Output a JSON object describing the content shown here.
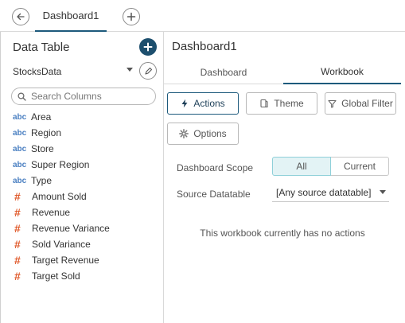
{
  "topbar": {
    "tab_label": "Dashboard1"
  },
  "left": {
    "title": "Data Table",
    "datasource": "StocksData",
    "search": {
      "placeholder": "Search Columns",
      "value": ""
    },
    "columns": [
      {
        "type": "abc",
        "label": "Area"
      },
      {
        "type": "abc",
        "label": "Region"
      },
      {
        "type": "abc",
        "label": "Store"
      },
      {
        "type": "abc",
        "label": "Super Region"
      },
      {
        "type": "abc",
        "label": "Type"
      },
      {
        "type": "#",
        "label": "Amount Sold"
      },
      {
        "type": "#",
        "label": "Revenue"
      },
      {
        "type": "#",
        "label": "Revenue Variance"
      },
      {
        "type": "#",
        "label": "Sold Variance"
      },
      {
        "type": "#",
        "label": "Target Revenue"
      },
      {
        "type": "#",
        "label": "Target Sold"
      }
    ]
  },
  "right": {
    "title": "Dashboard1",
    "tabs": {
      "dashboard": "Dashboard",
      "workbook": "Workbook"
    },
    "buttons": {
      "actions": "Actions",
      "theme": "Theme",
      "global_filter": "Global Filter",
      "options": "Options"
    },
    "scope": {
      "label": "Dashboard Scope",
      "all": "All",
      "current": "Current"
    },
    "source": {
      "label": "Source Datatable",
      "value": "[Any source datatable]"
    },
    "empty_message": "This workbook currently has no actions"
  },
  "colors": {
    "accent": "#1d5a7c",
    "string_type": "#4a7fc1",
    "numeric_type": "#e05a2b",
    "selected_bg": "#e3f3f5"
  }
}
